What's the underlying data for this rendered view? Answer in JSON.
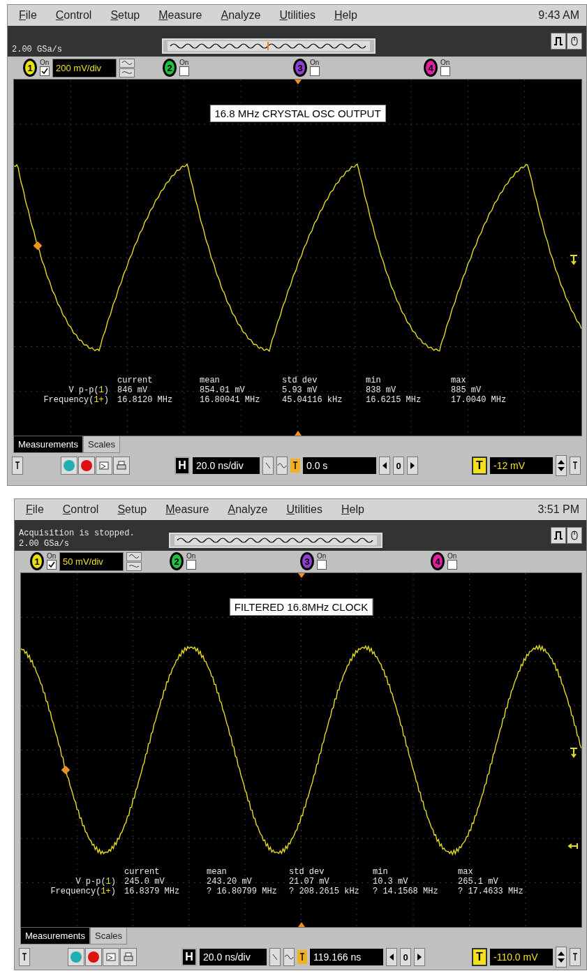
{
  "scopes": [
    {
      "menu": [
        "File",
        "Control",
        "Setup",
        "Measure",
        "Analyze",
        "Utilities",
        "Help"
      ],
      "clock": "9:43 AM",
      "status_lines": [
        "2.00 GSa/s"
      ],
      "overview_marker": true,
      "channels": [
        {
          "number": "1",
          "on_label": "On",
          "checked": true,
          "color": "#e8e010",
          "scale": "200 mV/div"
        },
        {
          "number": "2",
          "on_label": "On",
          "checked": false,
          "color": "#20c040"
        },
        {
          "number": "3",
          "on_label": "On",
          "checked": false,
          "color": "#9040d0"
        },
        {
          "number": "4",
          "on_label": "On",
          "checked": false,
          "color": "#e020a0"
        }
      ],
      "annotation": "16.8 MHz CRYSTAL OSC OUTPUT",
      "waveform": {
        "kind": "skewed"
      },
      "extra_marker": false,
      "measurements": {
        "columns": [
          "current",
          "mean",
          "std dev",
          "min",
          "max"
        ],
        "rows": [
          {
            "label_start": "V p-p(",
            "source": "1",
            "label_end": ")",
            "values": [
              "846 mV",
              "854.01 mV",
              "5.93 mV",
              "838 mV",
              "885 mV"
            ]
          },
          {
            "label_start": "Frequency(",
            "source": "1+",
            "label_end": ")",
            "values": [
              "16.8120 MHz",
              "16.80041 MHz",
              "45.04116 kHz",
              "16.6215 MHz",
              "17.0040 MHz"
            ]
          }
        ]
      },
      "tabs": [
        {
          "label": "Measurements",
          "selected": true
        },
        {
          "label": "Scales",
          "selected": false
        }
      ],
      "toolbar": {
        "horizontal": "H",
        "timebase": "20.0 ns/div",
        "position": "0.0 s",
        "delay_reset": "0",
        "trigger": "T",
        "trigger_level": "-12 mV"
      }
    },
    {
      "menu": [
        "File",
        "Control",
        "Setup",
        "Measure",
        "Analyze",
        "Utilities",
        "Help"
      ],
      "clock": "3:51 PM",
      "status_lines": [
        "Acquisition is stopped.",
        "2.00 GSa/s"
      ],
      "overview_marker": false,
      "channels": [
        {
          "number": "1",
          "on_label": "On",
          "checked": true,
          "color": "#e8e010",
          "scale": "50 mV/div"
        },
        {
          "number": "2",
          "on_label": "On",
          "checked": false,
          "color": "#20c040"
        },
        {
          "number": "3",
          "on_label": "On",
          "checked": false,
          "color": "#9040d0"
        },
        {
          "number": "4",
          "on_label": "On",
          "checked": false,
          "color": "#e020a0"
        }
      ],
      "annotation": "FILTERED 16.8MHz CLOCK",
      "waveform": {
        "kind": "sine"
      },
      "extra_marker": true,
      "measurements": {
        "columns": [
          "current",
          "mean",
          "std dev",
          "min",
          "max"
        ],
        "rows": [
          {
            "label_start": "V p-p(",
            "source": "1",
            "label_end": ")",
            "values": [
              "245.0 mV",
              "243.20 mV",
              "21.07 mV",
              "10.3 mV",
              "265.1 mV"
            ]
          },
          {
            "label_start": "Frequency(",
            "source": "1+",
            "label_end": ")",
            "values": [
              "16.8379 MHz",
              "? 16.80799 MHz",
              "? 208.2615 kHz",
              "? 14.1568 MHz",
              "? 17.4633 MHz"
            ]
          }
        ]
      },
      "tabs": [
        {
          "label": "Measurements",
          "selected": true
        },
        {
          "label": "Scales",
          "selected": false
        }
      ],
      "toolbar": {
        "horizontal": "H",
        "timebase": "20.0 ns/div",
        "position": "119.166 ns",
        "delay_reset": "0",
        "trigger": "T",
        "trigger_level": "-110.0 mV"
      }
    }
  ]
}
